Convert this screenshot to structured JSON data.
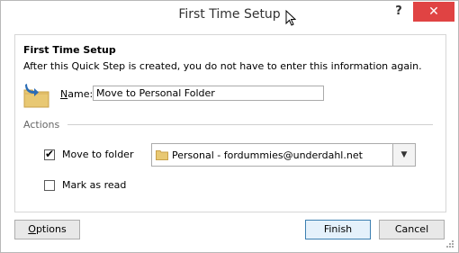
{
  "window": {
    "title": "First Time Setup",
    "help_label": "?",
    "close_label": "✕"
  },
  "content": {
    "heading": "First Time Setup",
    "description": "After this Quick Step is created, you do not have to enter this information again.",
    "name_label_first": "N",
    "name_label_rest": "ame:",
    "name_value": "Move to Personal Folder",
    "actions_label": "Actions",
    "move_to_folder": {
      "label": "Move to folder",
      "checked": true,
      "check_glyph": "✔",
      "selected_folder": "Personal - fordummies@underdahl.net",
      "dropdown_glyph": "▼"
    },
    "mark_as_read": {
      "label": "Mark as read",
      "checked": false
    }
  },
  "buttons": {
    "options_first": "O",
    "options_rest": "ptions",
    "finish": "Finish",
    "cancel": "Cancel"
  },
  "colors": {
    "close_red": "#e04343",
    "folder_yellow": "#e8c873",
    "arrow_blue": "#2b6cb5"
  }
}
